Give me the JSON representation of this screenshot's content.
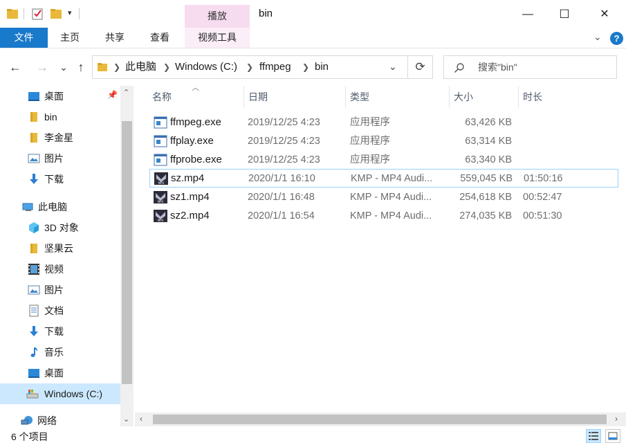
{
  "window": {
    "title": "bin",
    "context_tab": "播放",
    "minimize": "—",
    "maximize": "☐",
    "close": "✕"
  },
  "ribbon": {
    "tabs": [
      "文件",
      "主页",
      "共享",
      "查看",
      "视频工具"
    ]
  },
  "nav": {
    "back": "←",
    "forward": "→",
    "recent": "⌄",
    "up": "↑",
    "breadcrumbs": [
      "此电脑",
      "Windows (C:)",
      "ffmpeg",
      "bin"
    ],
    "search_placeholder": "搜索\"bin\""
  },
  "sidebar": {
    "items": [
      {
        "label": "桌面",
        "icon": "desktop-icon",
        "pinned": true
      },
      {
        "label": "bin",
        "icon": "folder-icon"
      },
      {
        "label": "李金星",
        "icon": "folder-icon"
      },
      {
        "label": "图片",
        "icon": "pictures-icon"
      },
      {
        "label": "下载",
        "icon": "download-icon"
      },
      {
        "label": "此电脑",
        "icon": "this-pc-icon"
      },
      {
        "label": "3D 对象",
        "icon": "3d-objects-icon"
      },
      {
        "label": "坚果云",
        "icon": "folder-icon"
      },
      {
        "label": "视频",
        "icon": "videos-icon"
      },
      {
        "label": "图片",
        "icon": "pictures-icon"
      },
      {
        "label": "文档",
        "icon": "documents-icon"
      },
      {
        "label": "下载",
        "icon": "download-icon"
      },
      {
        "label": "音乐",
        "icon": "music-icon"
      },
      {
        "label": "桌面",
        "icon": "desktop-icon"
      },
      {
        "label": "Windows (C:)",
        "icon": "drive-icon",
        "selected": true
      },
      {
        "label": "网络",
        "icon": "network-icon"
      }
    ]
  },
  "columns": [
    "名称",
    "日期",
    "类型",
    "大小",
    "时长"
  ],
  "files": [
    {
      "name": "ffmpeg.exe",
      "date": "2019/12/25 4:23",
      "type": "应用程序",
      "size": "63,426 KB",
      "duration": "",
      "icon": "exe-icon"
    },
    {
      "name": "ffplay.exe",
      "date": "2019/12/25 4:23",
      "type": "应用程序",
      "size": "63,314 KB",
      "duration": "",
      "icon": "exe-icon"
    },
    {
      "name": "ffprobe.exe",
      "date": "2019/12/25 4:23",
      "type": "应用程序",
      "size": "63,340 KB",
      "duration": "",
      "icon": "exe-icon"
    },
    {
      "name": "sz.mp4",
      "date": "2020/1/1 16:10",
      "type": "KMP - MP4 Audi...",
      "size": "559,045 KB",
      "duration": "01:50:16",
      "icon": "mp4-icon"
    },
    {
      "name": "sz1.mp4",
      "date": "2020/1/1 16:48",
      "type": "KMP - MP4 Audi...",
      "size": "254,618 KB",
      "duration": "00:52:47",
      "icon": "mp4-icon"
    },
    {
      "name": "sz2.mp4",
      "date": "2020/1/1 16:54",
      "type": "KMP - MP4 Audi...",
      "size": "274,035 KB",
      "duration": "00:51:30",
      "icon": "mp4-icon"
    }
  ],
  "status": {
    "count": "6 个项目"
  },
  "colors": {
    "accent": "#1979ca",
    "selection": "#cce8ff",
    "hover_border": "#99d1ff",
    "context_tab": "#f7dcef"
  }
}
